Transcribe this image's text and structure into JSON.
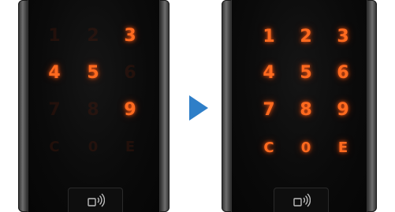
{
  "before": {
    "keys": [
      {
        "label": "1",
        "lit": false
      },
      {
        "label": "2",
        "lit": false
      },
      {
        "label": "3",
        "lit": true
      },
      {
        "label": "4",
        "lit": true
      },
      {
        "label": "5",
        "lit": true
      },
      {
        "label": "6",
        "lit": false
      },
      {
        "label": "7",
        "lit": false
      },
      {
        "label": "8",
        "lit": false
      },
      {
        "label": "9",
        "lit": true
      },
      {
        "label": "C",
        "lit": false
      },
      {
        "label": "0",
        "lit": false
      },
      {
        "label": "E",
        "lit": false
      }
    ]
  },
  "after": {
    "keys": [
      {
        "label": "1",
        "lit": true
      },
      {
        "label": "2",
        "lit": true
      },
      {
        "label": "3",
        "lit": true
      },
      {
        "label": "4",
        "lit": true
      },
      {
        "label": "5",
        "lit": true
      },
      {
        "label": "6",
        "lit": true
      },
      {
        "label": "7",
        "lit": true
      },
      {
        "label": "8",
        "lit": true
      },
      {
        "label": "9",
        "lit": true
      },
      {
        "label": "C",
        "lit": true
      },
      {
        "label": "0",
        "lit": true
      },
      {
        "label": "E",
        "lit": true
      }
    ]
  },
  "icons": {
    "nfc": "contactless-card-icon",
    "arrow": "arrow-right-icon"
  },
  "colors": {
    "key_glow": "#ff6a1f",
    "arrow": "#2f7fc8",
    "device_bg": "#0a0a0a"
  }
}
